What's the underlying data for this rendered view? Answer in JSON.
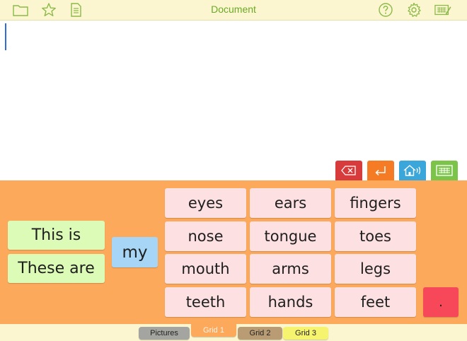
{
  "toolbar": {
    "title": "Document",
    "left_icons": [
      "folder-icon",
      "star-icon",
      "document-list-icon"
    ],
    "right_icons": [
      "help-icon",
      "settings-icon",
      "keyboard-edit-icon"
    ]
  },
  "document": {
    "text": ""
  },
  "actions": [
    {
      "name": "backspace-button",
      "icon": "backspace-icon",
      "color": "#d73b3b"
    },
    {
      "name": "enter-button",
      "icon": "return-icon",
      "color": "#f57c24"
    },
    {
      "name": "speak-button",
      "icon": "speak-home-icon",
      "color": "#3aa6d9"
    },
    {
      "name": "keyboard-button",
      "icon": "keyboard-icon",
      "color": "#7cc34a"
    }
  ],
  "grid": {
    "phrases": [
      "This is",
      "These are"
    ],
    "pronoun": "my",
    "words": [
      [
        "eyes",
        "ears",
        "fingers"
      ],
      [
        "nose",
        "tongue",
        "toes"
      ],
      [
        "mouth",
        "arms",
        "legs"
      ],
      [
        "teeth",
        "hands",
        "feet"
      ]
    ],
    "punctuation": "."
  },
  "tabs": [
    {
      "label": "Pictures",
      "color": "#a4a4a0"
    },
    {
      "label": "Grid 1",
      "color": "#fda95b",
      "active": true
    },
    {
      "label": "Grid 2",
      "color": "#b99c74"
    },
    {
      "label": "Grid 3",
      "color": "#f6f46e"
    }
  ],
  "colors": {
    "toolbar_bg": "#fbf6cf",
    "title_green": "#6ca829",
    "panel_orange": "#fda95b",
    "phrase_green": "#dcfbb6",
    "pronoun_blue": "#a7d5f5",
    "word_pink": "#fde0e1",
    "punct_red": "#f7485a"
  }
}
